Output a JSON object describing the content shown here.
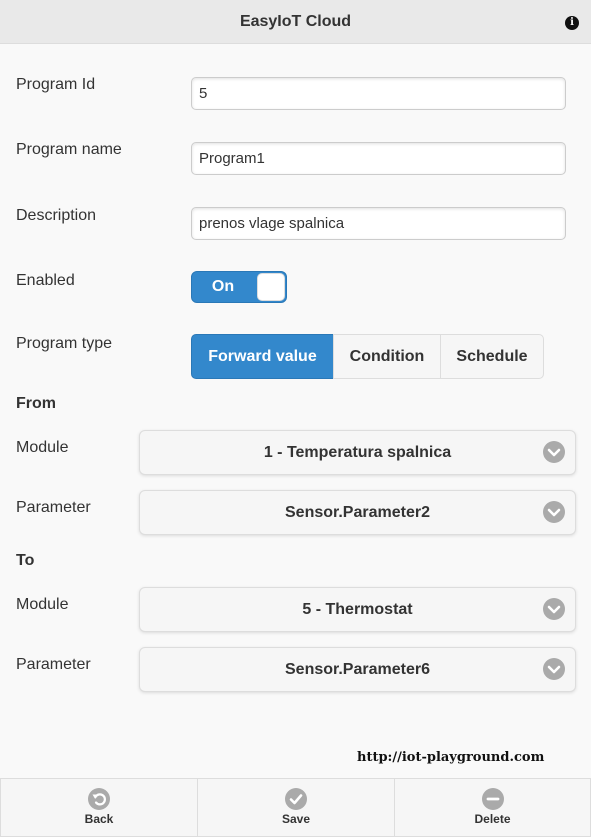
{
  "header": {
    "title": "EasyIoT Cloud",
    "info_icon": "info-icon"
  },
  "form": {
    "program_id_label": "Program Id",
    "program_id_value": "5",
    "program_name_label": "Program name",
    "program_name_value": "Program1",
    "description_label": "Description",
    "description_value": "prenos vlage spalnica",
    "enabled_label": "Enabled",
    "enabled_state": "On",
    "program_type_label": "Program type",
    "program_types": [
      "Forward value",
      "Condition",
      "Schedule"
    ],
    "program_type_selected": "Forward value"
  },
  "from": {
    "heading": "From",
    "module_label": "Module",
    "module_value": "1 - Temperatura spalnica",
    "parameter_label": "Parameter",
    "parameter_value": "Sensor.Parameter2"
  },
  "to": {
    "heading": "To",
    "module_label": "Module",
    "module_value": "5 - Thermostat",
    "parameter_label": "Parameter",
    "parameter_value": "Sensor.Parameter6"
  },
  "url": "http://iot-playground.com",
  "footer": {
    "back_label": "Back",
    "save_label": "Save",
    "delete_label": "Delete"
  },
  "colors": {
    "accent": "#3388cc",
    "header_bg": "#e9e9e9",
    "icon_gray": "#aaaaaa"
  }
}
